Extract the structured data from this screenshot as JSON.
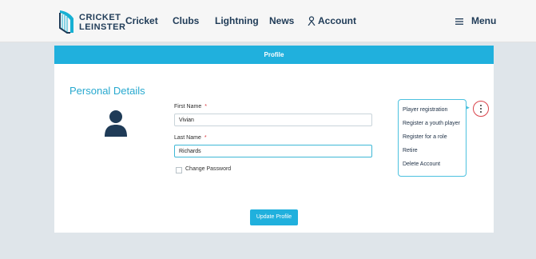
{
  "brand": {
    "line1_a": "CRICKET",
    "line1_b": "",
    "line2": "LEINSTER"
  },
  "nav": {
    "cricket": "Cricket",
    "clubs": "Clubs",
    "lightning": "Lightning",
    "news": "News",
    "account": "Account",
    "menu": "Menu"
  },
  "profile_bar": {
    "title": "Profile"
  },
  "personal": {
    "title": "Personal Details",
    "first_name_label": "First Name",
    "first_name_value": "Vivian",
    "last_name_label": "Last Name",
    "last_name_value": "Richards",
    "required_mark": "*",
    "change_password_label": "Change Password",
    "update_button": "Update Profile"
  },
  "dropdown": {
    "items": [
      "Player registration",
      "Register a youth player",
      "Register for a role",
      "Retire",
      "Delete Account"
    ]
  },
  "colors": {
    "accent": "#20b0dd",
    "navy": "#1f3b57",
    "required": "#d8343a"
  }
}
